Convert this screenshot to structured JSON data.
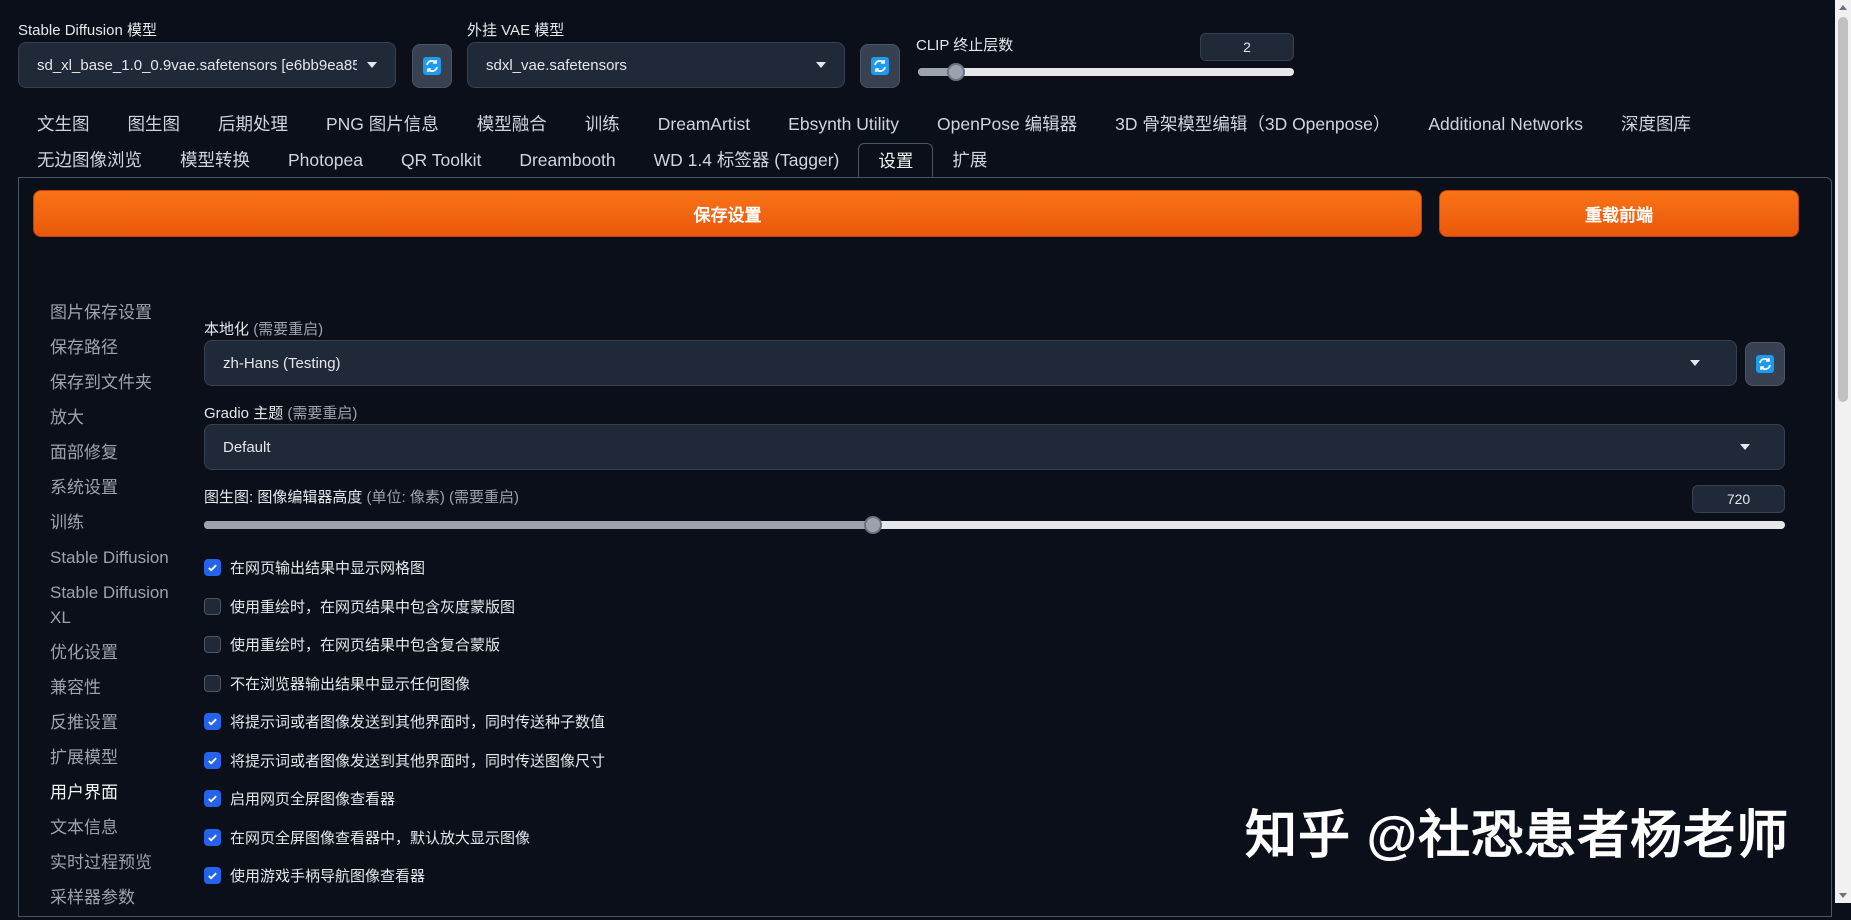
{
  "top": {
    "sd_model": {
      "label": "Stable Diffusion 模型",
      "value": "sd_xl_base_1.0_0.9vae.safetensors [e6bb9ea85"
    },
    "vae_model": {
      "label": "外挂 VAE 模型",
      "value": "sdxl_vae.safetensors"
    },
    "clip": {
      "label": "CLIP 终止层数",
      "value": "2",
      "fraction": 0.1
    }
  },
  "tabs_row1": [
    "文生图",
    "图生图",
    "后期处理",
    "PNG 图片信息",
    "模型融合",
    "训练",
    "DreamArtist",
    "Ebsynth Utility",
    "OpenPose 编辑器",
    "3D 骨架模型编辑（3D Openpose）",
    "Additional Networks",
    "深度图库"
  ],
  "tabs_row2": [
    "无边图像浏览",
    "模型转换",
    "Photopea",
    "QR Toolkit",
    "Dreambooth",
    "WD 1.4 标签器 (Tagger)",
    "设置",
    "扩展"
  ],
  "active_tab": "设置",
  "buttons": {
    "save": "保存设置",
    "reload": "重载前端"
  },
  "sidenav": [
    "图片保存设置",
    "保存路径",
    "保存到文件夹",
    "放大",
    "面部修复",
    "系统设置",
    "训练",
    "Stable Diffusion",
    "Stable Diffusion XL",
    "优化设置",
    "兼容性",
    "反推设置",
    "扩展模型",
    "用户界面",
    "文本信息",
    "实时过程预览",
    "采样器参数"
  ],
  "sidenav_active": "用户界面",
  "settings": {
    "localization": {
      "label": "本地化",
      "note": "(需要重启)",
      "value": "zh-Hans (Testing)"
    },
    "theme": {
      "label": "Gradio 主题",
      "note": "(需要重启)",
      "value": "Default"
    },
    "editor_height": {
      "label": "图生图: 图像编辑器高度",
      "note": "(单位: 像素) (需要重启)",
      "value": "720",
      "fraction": 0.423
    }
  },
  "checkboxes": [
    {
      "label": "在网页输出结果中显示网格图",
      "checked": true
    },
    {
      "label": "使用重绘时，在网页结果中包含灰度蒙版图",
      "checked": false
    },
    {
      "label": "使用重绘时，在网页结果中包含复合蒙版",
      "checked": false
    },
    {
      "label": "不在浏览器输出结果中显示任何图像",
      "checked": false
    },
    {
      "label": "将提示词或者图像发送到其他界面时，同时传送种子数值",
      "checked": true
    },
    {
      "label": "将提示词或者图像发送到其他界面时，同时传送图像尺寸",
      "checked": true
    },
    {
      "label": "启用网页全屏图像查看器",
      "checked": true
    },
    {
      "label": "在网页全屏图像查看器中，默认放大显示图像",
      "checked": true
    },
    {
      "label": "使用游戏手柄导航图像查看器",
      "checked": true
    }
  ],
  "watermark": "知乎 @社恐患者杨老师",
  "colors": {
    "accent": "#f97316",
    "check": "#2563eb",
    "background": "#0b0f19"
  }
}
